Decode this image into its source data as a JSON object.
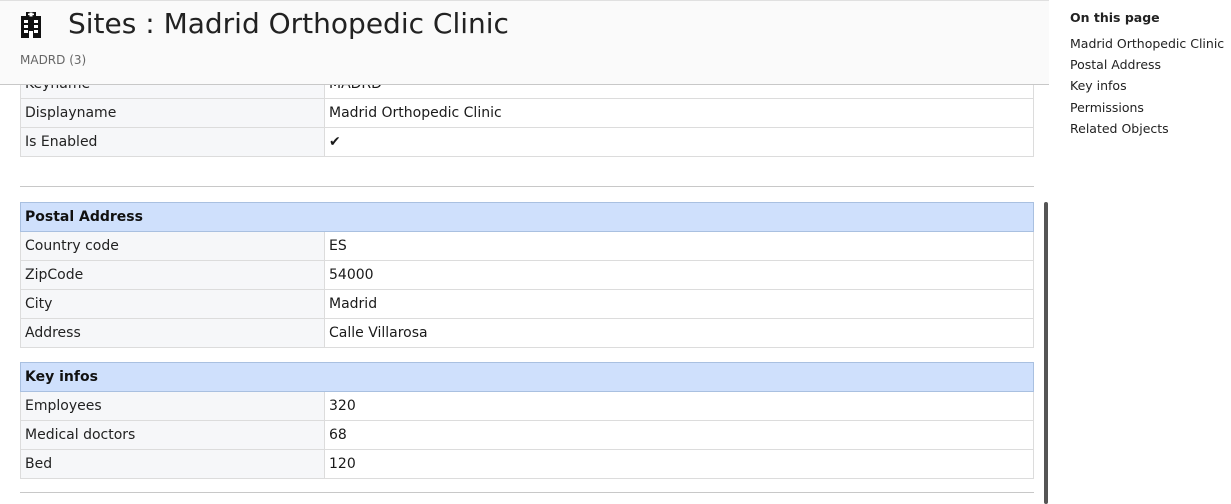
{
  "header": {
    "icon": "hospital-building-icon",
    "title": "Sites : Madrid Orthopedic Clinic",
    "subtitle": "MADRD (3)"
  },
  "general": {
    "rows": [
      {
        "label": "Keyname",
        "value": "MADRD"
      },
      {
        "label": "Displayname",
        "value": "Madrid Orthopedic Clinic"
      },
      {
        "label": "Is Enabled",
        "value": "✔"
      }
    ]
  },
  "postal_address": {
    "heading": "Postal Address",
    "rows": [
      {
        "label": "Country code",
        "value": "ES"
      },
      {
        "label": "ZipCode",
        "value": "54000"
      },
      {
        "label": "City",
        "value": "Madrid"
      },
      {
        "label": "Address",
        "value": "Calle Villarosa"
      }
    ]
  },
  "key_infos": {
    "heading": "Key infos",
    "rows": [
      {
        "label": "Employees",
        "value": "320"
      },
      {
        "label": "Medical doctors",
        "value": "68"
      },
      {
        "label": "Bed",
        "value": "120"
      }
    ]
  },
  "toc": {
    "title": "On this page",
    "items": [
      "Madrid Orthopedic Clinic",
      "Postal Address",
      "Key infos",
      "Permissions",
      "Related Objects"
    ]
  }
}
